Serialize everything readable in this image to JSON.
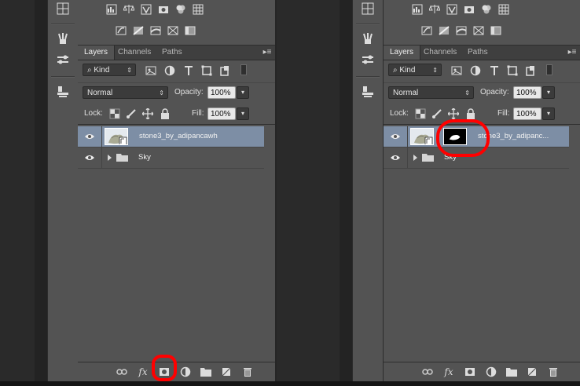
{
  "tabs": [
    "Layers",
    "Channels",
    "Paths"
  ],
  "filter": {
    "kind_label": "Kind",
    "search_icon": "search-icon"
  },
  "blend": {
    "mode": "Normal",
    "opacity_label": "Opacity:",
    "opacity_value": "100%"
  },
  "lock": {
    "lock_label": "Lock:",
    "fill_label": "Fill:",
    "fill_value": "100%"
  },
  "left": {
    "layers": [
      {
        "name": "stone3_by_adipancawh",
        "type": "layer",
        "visible": true,
        "selected": true
      },
      {
        "name": "Sky",
        "type": "group",
        "visible": true,
        "selected": false
      }
    ],
    "highlight": "add-layer-mask-button"
  },
  "right": {
    "layers": [
      {
        "name": "stone3_by_adipanc...",
        "type": "layer",
        "visible": true,
        "selected": true,
        "has_mask": true
      },
      {
        "name": "Sky",
        "type": "group",
        "visible": true,
        "selected": false
      }
    ],
    "highlight": "layer-mask-thumbnail"
  },
  "footer_icons": [
    "link-icon",
    "fx-icon",
    "mask-icon",
    "adjustment-icon",
    "folder-icon",
    "new-layer-icon",
    "trash-icon"
  ],
  "colors": {
    "selection": "#7d8ea5",
    "annotation": "#ff0000",
    "panel": "#535353"
  }
}
